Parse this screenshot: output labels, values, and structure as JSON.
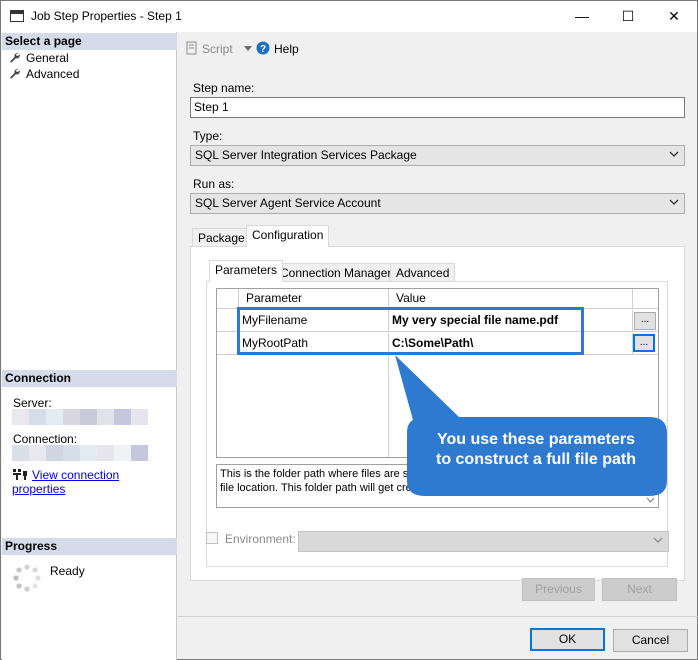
{
  "window": {
    "title": "Job Step Properties - Step 1",
    "minimize_glyph": "—",
    "maximize_glyph": "☐",
    "close_glyph": "✕"
  },
  "left_pane": {
    "select_page_header": "Select a page",
    "pages": [
      {
        "label": "General",
        "icon": "wrench-icon"
      },
      {
        "label": "Advanced",
        "icon": "wrench-icon"
      }
    ],
    "connection_header": "Connection",
    "server_label": "Server:",
    "connection_label": "Connection:",
    "view_connection_link": "View connection properties",
    "progress_header": "Progress",
    "progress_status": "Ready"
  },
  "toolbar": {
    "script_label": "Script",
    "help_label": "Help"
  },
  "form": {
    "step_name_label": "Step name:",
    "step_name_value": "Step 1",
    "type_label": "Type:",
    "type_value": "SQL Server Integration Services Package",
    "run_as_label": "Run as:",
    "run_as_value": "SQL Server Agent Service Account"
  },
  "outer_tabs": [
    {
      "label": "Package",
      "active": false
    },
    {
      "label": "Configuration",
      "active": true
    }
  ],
  "inner_tabs": [
    {
      "label": "Parameters",
      "active": true
    },
    {
      "label": "Connection Managers",
      "active": false
    },
    {
      "label": "Advanced",
      "active": false
    }
  ],
  "parameters_grid": {
    "columns": [
      "Parameter",
      "Value"
    ],
    "rows": [
      {
        "parameter": "MyFilename",
        "value": "My very special file name.pdf",
        "button": "..."
      },
      {
        "parameter": "MyRootPath",
        "value": "C:\\Some\\Path\\",
        "button": "..."
      }
    ]
  },
  "description": {
    "line1": "This is the folder path where files are sav",
    "line2": "file location.  This folder path will get created if it doesn't already exist."
  },
  "environment": {
    "label": "Environment:",
    "value": ""
  },
  "nav_buttons": {
    "previous": "Previous",
    "next": "Next"
  },
  "dialog_buttons": {
    "ok": "OK",
    "cancel": "Cancel"
  },
  "callout": {
    "line1": "You use these parameters",
    "line2": "to construct a full file path"
  },
  "colors": {
    "highlight_border": "#2f7ad1",
    "callout_fill": "#2f7ad1",
    "section_header": "#d6dbe9",
    "link": "#0000ee",
    "redacted_tiles": [
      "#e8e8ee",
      "#d4dde8",
      "#e3ecf2",
      "#d8d6e0",
      "#c8ccd8",
      "#e2e2ea",
      "#c5c8dc",
      "#e6e4ec",
      "#cfd6e2",
      "#dadfe8"
    ]
  }
}
